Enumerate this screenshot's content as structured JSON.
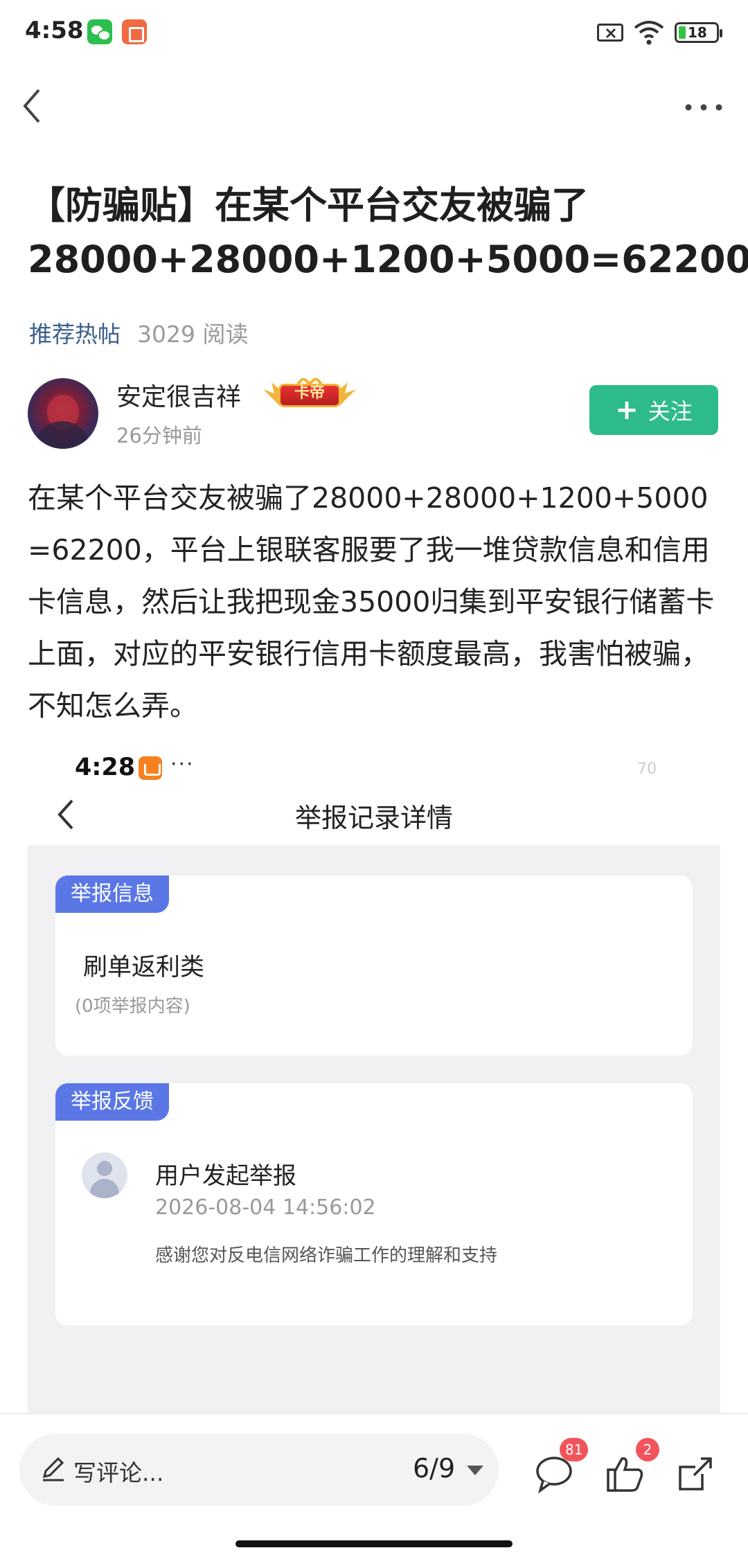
{
  "status_bar": {
    "time": "4:58",
    "battery": "18"
  },
  "post": {
    "title": "【防骗贴】在某个平台交友被骗了28000+28000+1200+5000=62200",
    "tag": "推荐热帖",
    "read_count": "3029 阅读",
    "author": {
      "name": "安定很吉祥",
      "rank_badge": "卡帝",
      "time": "26分钟前"
    },
    "follow_label": "关注",
    "body": "在某个平台交友被骗了28000+28000+1200+5000=62200，平台上银联客服要了我一堆贷款信息和信用卡信息，然后让我把现金35000归集到平安银行储蓄卡上面，对应的平安银行信用卡额度最高，我害怕被骗，不知怎么弄。"
  },
  "screenshot": {
    "time": "4:28",
    "dots": "···",
    "battery": "70",
    "title": "举报记录详情",
    "info_card": {
      "tag": "举报信息",
      "type": "刷单返利类",
      "count": "(0项举报内容)"
    },
    "feedback_card": {
      "tag": "举报反馈",
      "action": "用户发起举报",
      "date": "2026-08-04 14:56:02",
      "thanks": "感谢您对反电信网络诈骗工作的理解和支持"
    }
  },
  "bottom_bar": {
    "comment_placeholder": "写评论...",
    "page_indicator": "6/9",
    "comment_count": "81",
    "like_count": "2"
  },
  "icons": [
    "back-icon",
    "more-icon",
    "wechat-icon",
    "app-notification-icon",
    "sim-off-icon",
    "wifi-icon",
    "battery-icon",
    "pencil-icon",
    "comment-icon",
    "like-icon",
    "share-icon",
    "caret-down-icon"
  ],
  "colors": {
    "follow": "#2dbb8c",
    "tag_link": "#3a5f8c",
    "card_tag": "#5b77e6",
    "badge": "#f2545b"
  }
}
